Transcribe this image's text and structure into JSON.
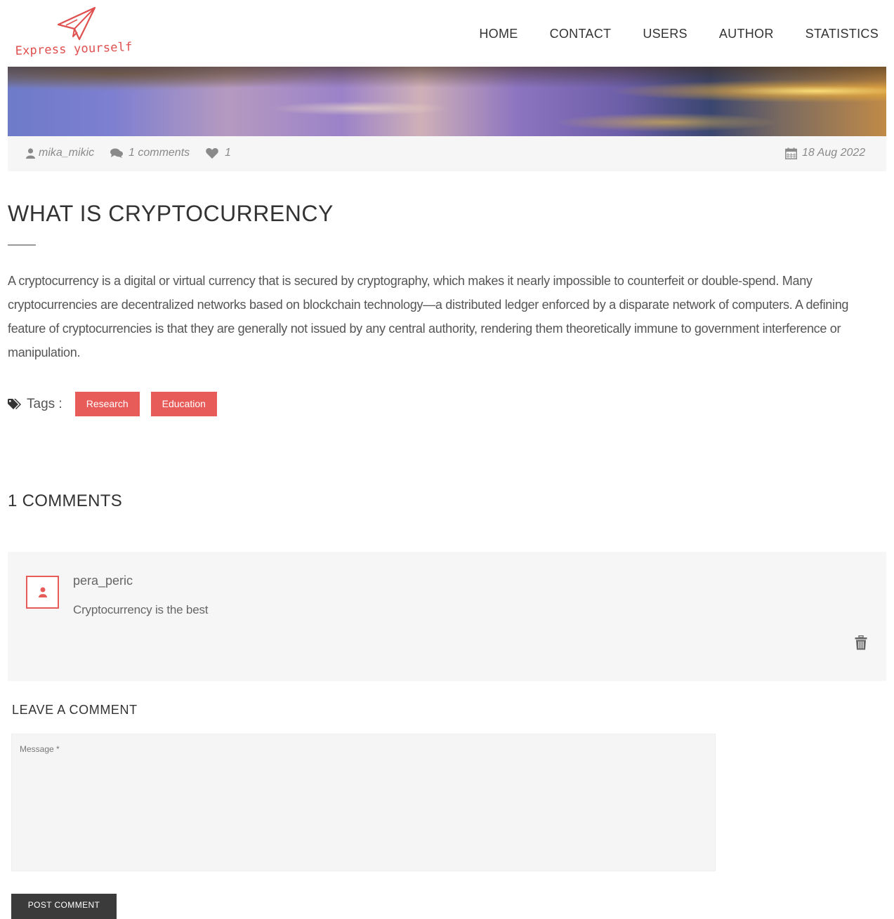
{
  "brand": {
    "logo_text": "Express yourself",
    "accent_color": "#e75b58"
  },
  "nav": {
    "items": [
      "HOME",
      "CONTACT",
      "USERS",
      "AUTHOR",
      "STATISTICS"
    ]
  },
  "post": {
    "author": "mika_mikic",
    "comments_count": "1 comments",
    "likes": "1",
    "date": "18 Aug 2022",
    "title": "WHAT IS CRYPTOCURRENCY",
    "body": "A cryptocurrency is a digital or virtual currency that is secured by cryptography, which makes it nearly impossible to counterfeit or double-spend. Many cryptocurrencies are decentralized networks based on blockchain technology—a distributed ledger enforced by a disparate network of computers. A defining feature of cryptocurrencies is that they are generally not issued by any central authority, rendering them theoretically immune to government interference or manipulation.",
    "tags_label": "Tags :",
    "tags": [
      "Research",
      "Education"
    ]
  },
  "comments": {
    "heading": "1 COMMENTS",
    "items": [
      {
        "author": "pera_peric",
        "text": "Cryptocurrency is the best"
      }
    ]
  },
  "comment_form": {
    "heading": "LEAVE A COMMENT",
    "message_placeholder": "Message *",
    "message_value": "",
    "submit_label": "POST COMMENT"
  },
  "icons": {
    "logo": "paper-plane-icon",
    "author": "user-icon",
    "comments": "comments-icon",
    "likes": "heart-icon",
    "date": "calendar-icon",
    "tags": "tags-icon",
    "avatar": "user-icon",
    "delete": "trash-icon"
  }
}
